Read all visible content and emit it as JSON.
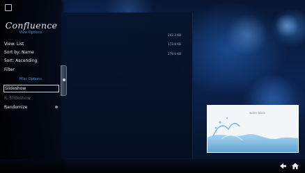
{
  "app": {
    "logo_text": "Confluence"
  },
  "sidebar": {
    "view_options_title": "View Options",
    "view_items": [
      {
        "label": "View: List",
        "enabled": true
      },
      {
        "label": "Sort by: Name",
        "enabled": true
      },
      {
        "label": "Sort: Ascending",
        "enabled": true
      },
      {
        "label": "Filter",
        "enabled": true
      }
    ],
    "misc_options_title": "Misc Options",
    "misc_items": [
      {
        "label": "Slideshow",
        "enabled": true,
        "focused": true
      },
      {
        "label": "R. Slideshow",
        "enabled": false
      },
      {
        "label": "Randomize",
        "enabled": true
      }
    ]
  },
  "file_list": {
    "rows": [
      {
        "size": "242.3 KB"
      },
      {
        "size": "173.8 KB"
      },
      {
        "size": "279.9 KB"
      }
    ]
  },
  "preview": {
    "caption": "water basic"
  },
  "footer": {
    "back_icon": "back-arrow-icon",
    "home_icon": "home-icon"
  },
  "theme": {
    "accent": "#4f8fd6",
    "text": "#e8edf5",
    "disabled": "#5b6472"
  }
}
